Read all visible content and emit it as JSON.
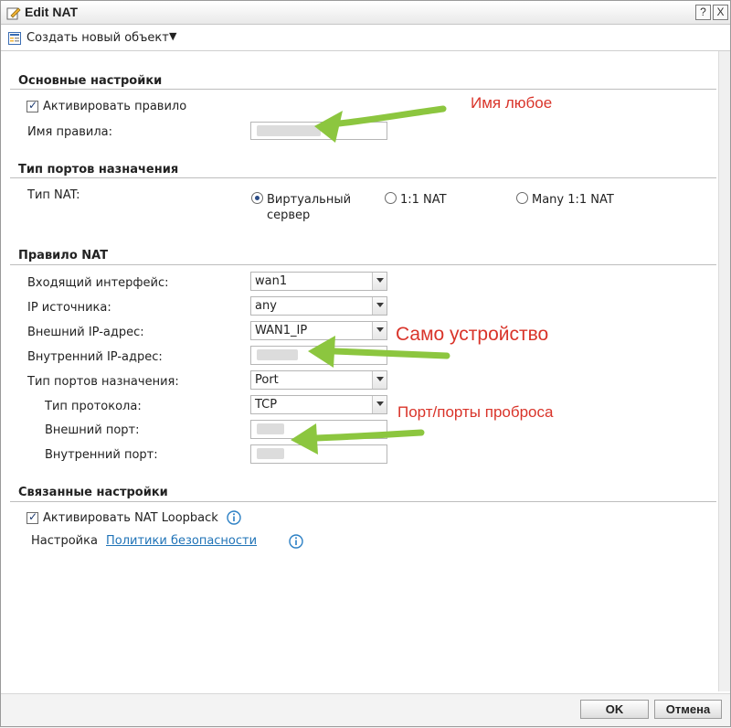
{
  "window": {
    "title": "Edit NAT",
    "help_label": "?",
    "close_label": "X"
  },
  "toolbar": {
    "create_label": "Создать новый объект"
  },
  "sections": {
    "basic": "Основные настройки",
    "dest_ports": "Тип портов назначения",
    "nat_rule": "Правило NAT",
    "related": "Связанные настройки"
  },
  "basic": {
    "activate_label": "Активировать правило",
    "activate_checked": true,
    "name_label": "Имя правила:",
    "name_value": ""
  },
  "nat_type": {
    "label": "Тип NAT:",
    "options": [
      "Виртуальный",
      "1:1 NAT",
      "Many 1:1 NAT"
    ],
    "option0_line2": "сервер",
    "selected": 0
  },
  "nat_rule": {
    "incoming_if_label": "Входящий интерфейс:",
    "incoming_if_value": "wan1",
    "source_ip_label": "IP источника:",
    "source_ip_value": "any",
    "external_ip_label": "Внешний IP-адрес:",
    "external_ip_value": "WAN1_IP",
    "internal_ip_label": "Внутренний IP-адрес:",
    "internal_ip_value": "",
    "port_type_label": "Тип портов назначения:",
    "port_type_value": "Port",
    "protocol_label": "Тип протокола:",
    "protocol_value": "TCP",
    "ext_port_label": "Внешний порт:",
    "ext_port_value": "",
    "int_port_label": "Внутренний порт:",
    "int_port_value": ""
  },
  "related": {
    "loopback_label": "Активировать NAT Loopback",
    "loopback_checked": true,
    "policy_prefix": "Настройка",
    "policy_link": "Политики безопасности"
  },
  "annotations": {
    "name_note": "Имя любое",
    "device_note": "Само устройство",
    "ports_note": "Порт/порты проброса"
  },
  "footer": {
    "ok_label": "OK",
    "cancel_label": "Отмена"
  },
  "colors": {
    "annotation": "#d9342a",
    "arrow": "#8cc63f",
    "link": "#1f73b7"
  }
}
